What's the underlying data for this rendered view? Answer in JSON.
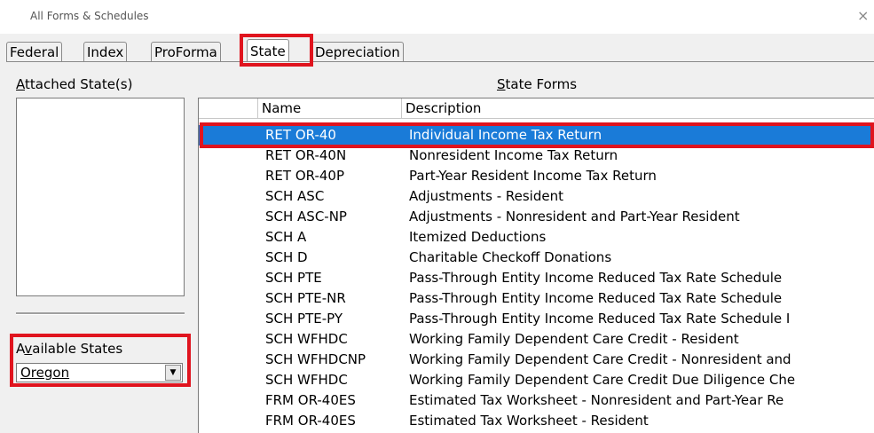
{
  "window": {
    "title": "All Forms & Schedules",
    "close_glyph": "×"
  },
  "tabs": [
    {
      "label": "Federal",
      "active": false
    },
    {
      "label": "Index",
      "active": false
    },
    {
      "label": "ProForma",
      "active": false
    },
    {
      "label": "State",
      "active": true
    },
    {
      "label": "Depreciation",
      "active": false
    }
  ],
  "attached": {
    "label_first": "A",
    "label_rest": "ttached State(s)"
  },
  "available": {
    "label_first": "A",
    "label_u": "v",
    "label_rest": "ailable States",
    "selected": "Oregon"
  },
  "forms": {
    "title_u": "S",
    "title_rest": "tate Forms",
    "columns": [
      "Name",
      "Description"
    ],
    "rows": [
      {
        "name": "RET OR-40",
        "desc": "Individual Income Tax Return"
      },
      {
        "name": "RET OR-40N",
        "desc": "Nonresident Income Tax Return"
      },
      {
        "name": "RET OR-40P",
        "desc": "Part-Year Resident Income Tax Return"
      },
      {
        "name": "SCH ASC",
        "desc": "Adjustments - Resident"
      },
      {
        "name": "SCH ASC-NP",
        "desc": "Adjustments - Nonresident and Part-Year Resident"
      },
      {
        "name": "SCH A",
        "desc": "Itemized Deductions"
      },
      {
        "name": "SCH D",
        "desc": "Charitable Checkoff Donations"
      },
      {
        "name": "SCH PTE",
        "desc": "Pass-Through Entity Income Reduced Tax Rate Schedule"
      },
      {
        "name": "SCH PTE-NR",
        "desc": "Pass-Through Entity Income Reduced Tax Rate Schedule"
      },
      {
        "name": "SCH PTE-PY",
        "desc": "Pass-Through Entity Income Reduced Tax Rate Schedule I"
      },
      {
        "name": "SCH WFHDC",
        "desc": "Working Family Dependent Care Credit - Resident"
      },
      {
        "name": "SCH WFHDCNP",
        "desc": "Working Family Dependent Care Credit - Nonresident and"
      },
      {
        "name": "SCH WFHDC",
        "desc": "Working Family Dependent Care Credit Due Diligence Che"
      },
      {
        "name": "FRM OR-40ES",
        "desc": "Estimated Tax Worksheet - Nonresident and Part-Year Re"
      },
      {
        "name": "FRM OR-40ES",
        "desc": "Estimated Tax Worksheet - Resident"
      }
    ],
    "selected_index": 0
  },
  "colors": {
    "highlight": "#e0141e",
    "selection": "#1a7bd8"
  }
}
